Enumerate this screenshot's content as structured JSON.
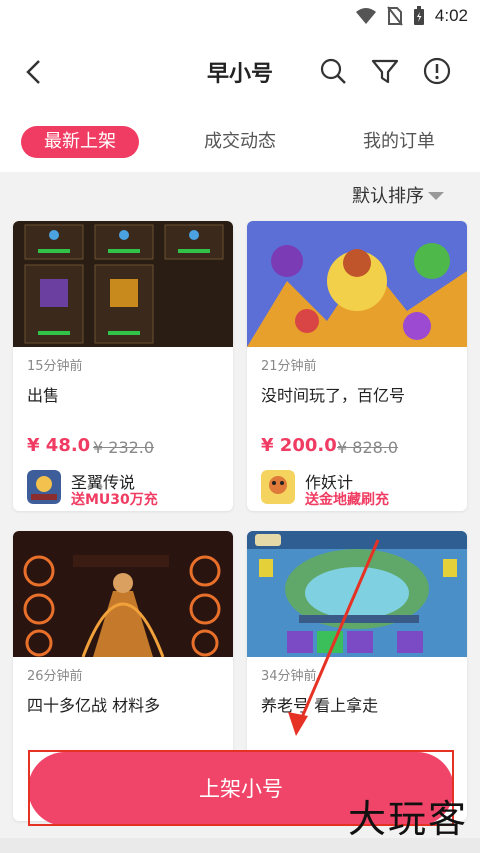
{
  "status_bar": {
    "time": "4:02"
  },
  "header": {
    "title": "早小号"
  },
  "tabs": [
    {
      "label": "最新上架",
      "active": true
    },
    {
      "label": "成交动态",
      "active": false
    },
    {
      "label": "我的订单",
      "active": false
    }
  ],
  "sort": {
    "label": "默认排序"
  },
  "listings": [
    {
      "time": "15分钟前",
      "title": "出售",
      "price": "¥ 48.0",
      "original": "¥ 232.0",
      "game": "圣翼传说",
      "promo": "送MU30万充"
    },
    {
      "time": "21分钟前",
      "title": "没时间玩了，百亿号",
      "price": "¥ 200.0",
      "original": "¥ 828.0",
      "game": "作妖计",
      "promo": "送金地藏刷充"
    },
    {
      "time": "26分钟前",
      "title": "四十多亿战 材料多"
    },
    {
      "time": "34分钟前",
      "title": "养老号   看上拿走"
    }
  ],
  "cta": {
    "label": "上架小号"
  },
  "watermark": "大玩客",
  "colors": {
    "accent": "#f03c62",
    "annotation_red": "#e53224"
  },
  "icons": [
    "back-icon",
    "search-icon",
    "filter-icon",
    "info-icon",
    "wifi-icon",
    "no-sim-icon",
    "battery-icon"
  ]
}
